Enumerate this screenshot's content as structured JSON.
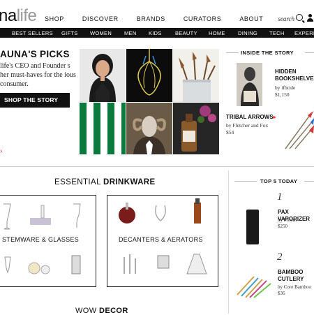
{
  "brand": {
    "logo_dark": "na",
    "logo_light": "life"
  },
  "top_nav": [
    "SHOP",
    "DISCOVER",
    "BRANDS",
    "CURATORS",
    "ABOUT"
  ],
  "search": {
    "label": "search"
  },
  "categories": [
    "BEST SELLERS",
    "GIFTS",
    "WOMEN",
    "MEN",
    "KIDS",
    "BEAUTY",
    "HOME",
    "DINING",
    "TECH",
    "EXPERI"
  ],
  "hero": {
    "title": "AUNA'S PICKS",
    "description": "life's CEO and Founder s her must-haves for the ious consumer.",
    "button": "SHOP THE STORY",
    "arrow": "›"
  },
  "inside_story": {
    "heading": "INSIDE THE STORY",
    "items": [
      {
        "title": "HIDDEN BOOKSHELVES",
        "by": "by ifbride",
        "price": "$1,150"
      },
      {
        "title": "TRIBAL ARROWS",
        "by": "by Fletcher and Fox",
        "price": "$54"
      }
    ]
  },
  "drinkware": {
    "title_light": "ESSENTIAL ",
    "title_bold": "DRINKWARE",
    "box1_label": "STEMWARE & GLASSES",
    "box2_label": "DECANTERS & AERATORS"
  },
  "top5": {
    "heading": "TOP 5 TODAY",
    "items": [
      {
        "rank": "1",
        "title": "PAX VAPORIZER",
        "by": "by Ploom",
        "price": "$250"
      },
      {
        "rank": "2",
        "title": "BAMBOO CUTLERY",
        "by": "by Core Bamboo",
        "price": "$36"
      }
    ]
  },
  "wow": {
    "light": "WOW ",
    "bold": "DECOR"
  },
  "colors": {
    "accent": "#e33333",
    "nav_bg": "#111111",
    "stripe_green": "#0d7a3d"
  }
}
